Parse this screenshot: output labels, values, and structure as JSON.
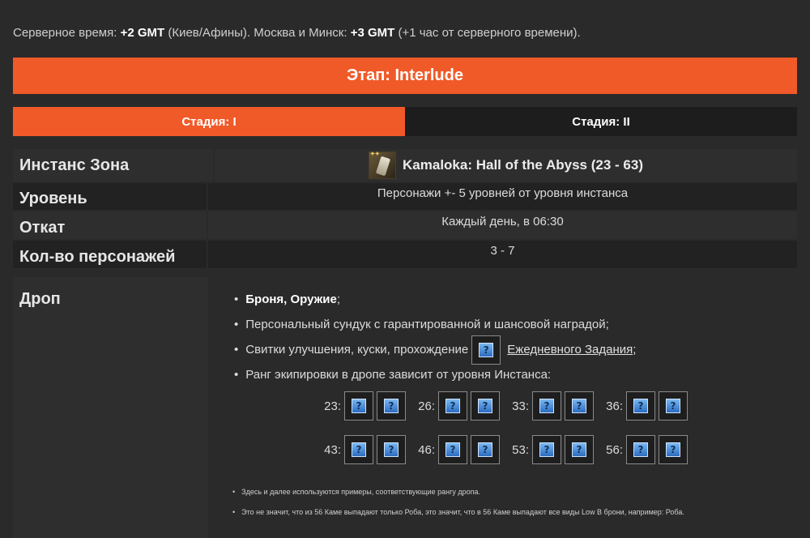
{
  "server_time": {
    "prefix": "Серверное время: ",
    "gmt1": "+2 GMT",
    "middle": " (Киев/Афины). Москва и Минск: ",
    "gmt2": "+3 GMT",
    "suffix": " (+1 час от серверного времени)."
  },
  "stage_banner": "Этап: Interlude",
  "tabs": [
    {
      "label": "Стадия: I",
      "active": true
    },
    {
      "label": "Стадия: II",
      "active": false
    }
  ],
  "info": {
    "instance_label": "Инстанс Зона",
    "instance_value": "Kamaloka: Hall of the Abyss (23 - 63)",
    "level_label": "Уровень",
    "level_value": "Персонажи +- 5 уровней от уровня инстанса",
    "reset_label": "Откат",
    "reset_value": "Каждый день, в 06:30",
    "party_label": "Кол-во персонажей",
    "party_value": "3 - 7"
  },
  "drop": {
    "label": "Дроп",
    "item1_bold": "Броня, Оружие",
    "item1_tail": ";",
    "item2": "Персональный сундук с гарантированной и шансовой наградой;",
    "item3_text": "Свитки улучшения, куски, прохождение",
    "item3_link": "Ежедневного Задания",
    "item3_tail": ";",
    "item4": "Ранг экипировки в дропе зависит от уровня Инстанса:",
    "grades_row1": [
      "23:",
      "26:",
      "33:",
      "36:"
    ],
    "grades_row2": [
      "43:",
      "46:",
      "53:",
      "56:"
    ],
    "unknown_icon": "?",
    "note1": "Здесь и далее используются примеры, соответствующие рангу дропа.",
    "note2": "Это не значит, что из 56 Каме выпадают только Роба, это значит, что в 56 Каме выпадают все виды Low B брони, например: Роба."
  },
  "colors": {
    "accent": "#f05a28",
    "background": "#2a2a2a"
  }
}
